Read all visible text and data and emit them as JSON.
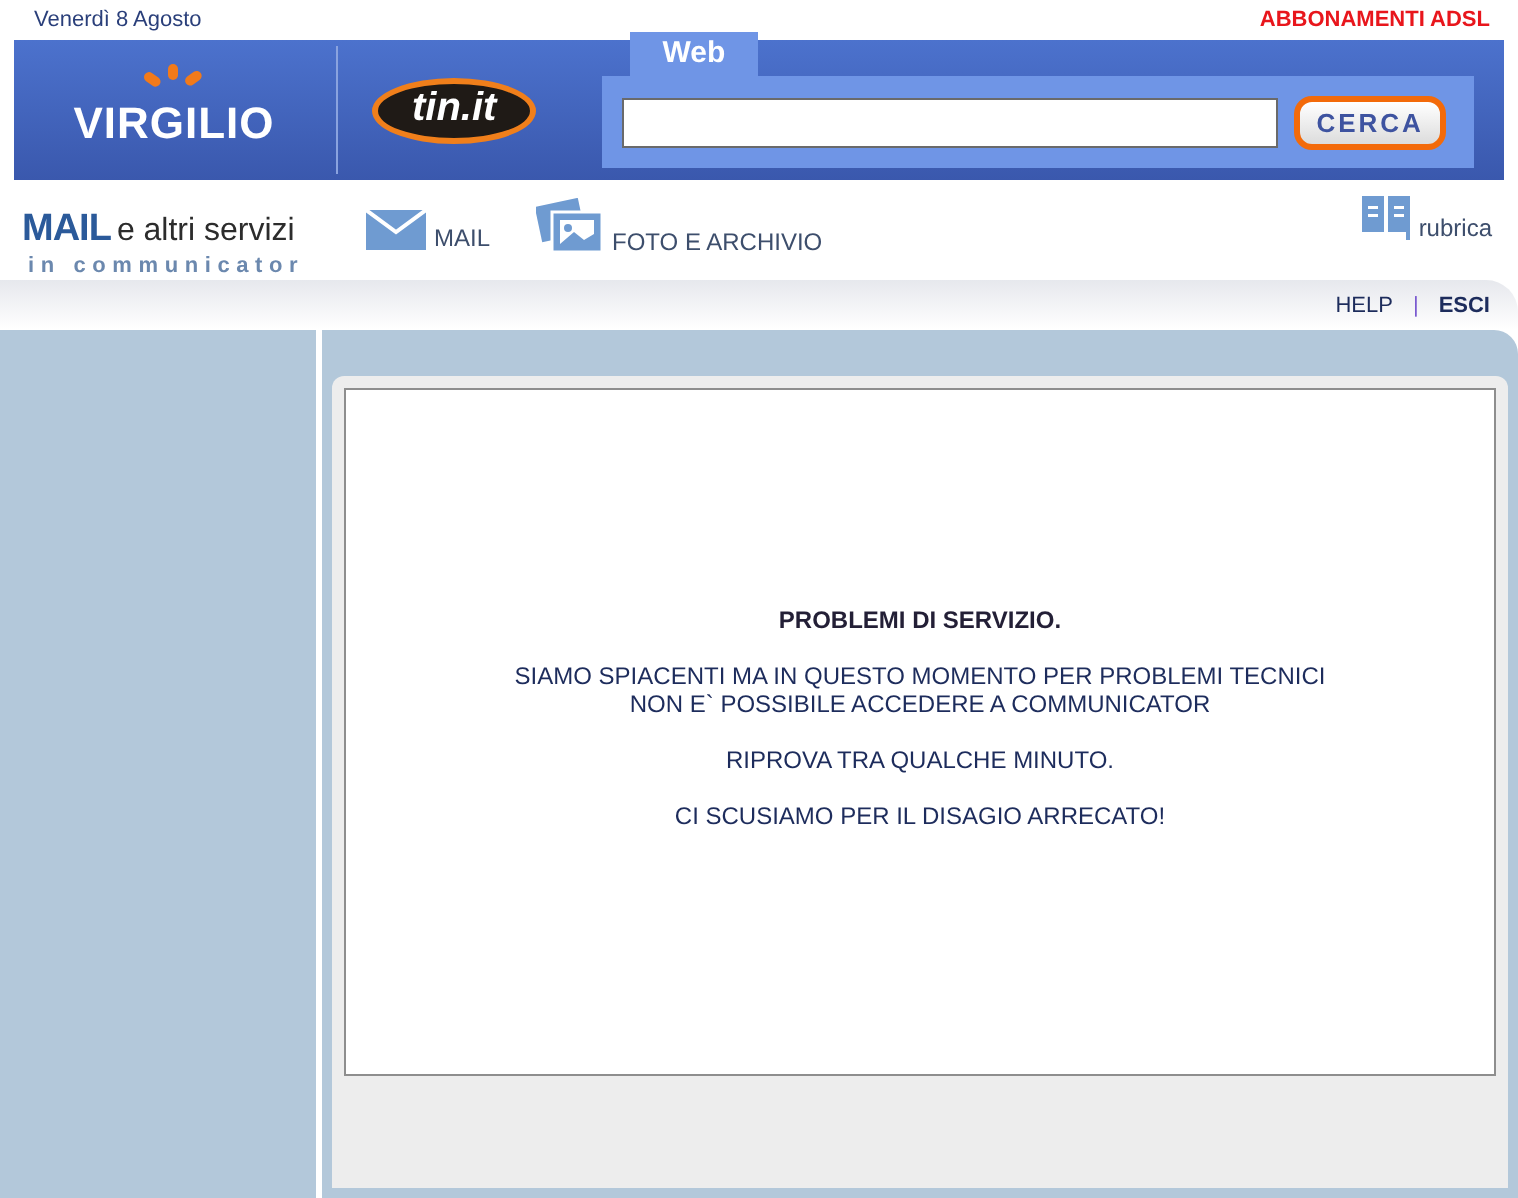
{
  "top_bar": {
    "date": "Venerdì 8 Agosto",
    "promo_link": "ABBONAMENTI ADSL"
  },
  "banner": {
    "logo_primary": "VIRGILIO",
    "logo_secondary": "tin.it",
    "search_tab": "Web",
    "search_button": "CERCA"
  },
  "service_bar": {
    "title_bold": "MAIL",
    "title_rest": "e altri servizi",
    "subtitle": "in communicator",
    "links": [
      {
        "kind": "mail",
        "label": "MAIL"
      },
      {
        "kind": "photo",
        "label": "FOTO E ARCHIVIO"
      }
    ],
    "address_book": "rubrica"
  },
  "sub_nav": {
    "help": "HELP",
    "separator": "|",
    "logout": "ESCI"
  },
  "message": {
    "heading": "PROBLEMI DI SERVIZIO.",
    "paragraphs": [
      {
        "lines": [
          "SIAMO SPIACENTI MA IN QUESTO MOMENTO PER PROBLEMI TECNICI",
          "NON E` POSSIBILE ACCEDERE A COMMUNICATOR"
        ]
      },
      {
        "lines": [
          "RIPROVA TRA QUALCHE MINUTO."
        ]
      },
      {
        "lines": [
          "CI SCUSIAMO PER IL DISAGIO ARRECATO!"
        ]
      }
    ]
  }
}
